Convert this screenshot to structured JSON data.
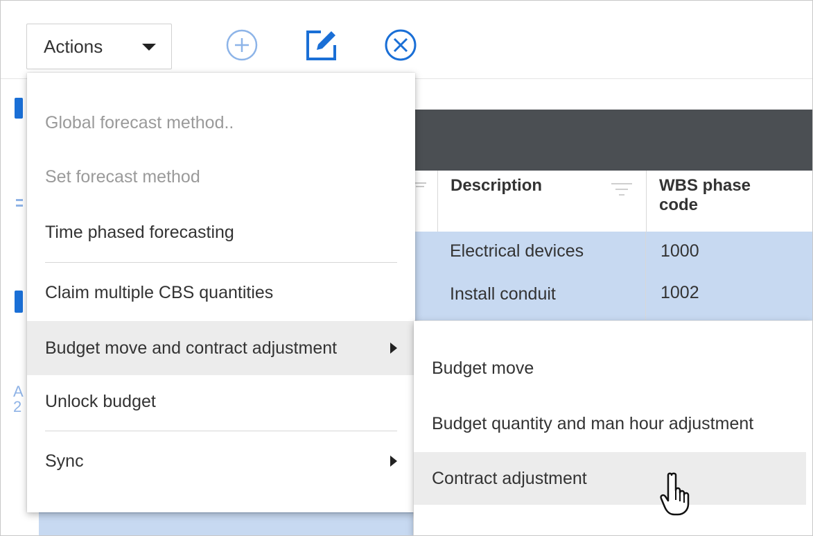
{
  "toolbar": {
    "actions_label": "Actions",
    "icons": [
      "add-icon",
      "edit-icon",
      "cancel-icon"
    ]
  },
  "grid": {
    "columns": [
      {
        "label": "Description"
      },
      {
        "label": "WBS phase code"
      }
    ],
    "rows": [
      {
        "description": "Electrical devices",
        "wbs": "1000"
      },
      {
        "description": "Install conduit",
        "wbs": "1002"
      }
    ],
    "left_partial_text": "A\n2"
  },
  "actions_menu": {
    "items": [
      {
        "label": "Global forecast method..",
        "disabled": true
      },
      {
        "label": "Set forecast method",
        "disabled": true
      },
      {
        "label": "Time phased forecasting",
        "disabled": false
      },
      {
        "label": "Claim multiple CBS quantities",
        "disabled": false
      },
      {
        "label": "Budget move and contract adjustment",
        "disabled": false,
        "has_submenu": true,
        "highlighted": true
      },
      {
        "label": "Unlock budget",
        "disabled": false
      },
      {
        "label": "Sync",
        "disabled": false,
        "has_submenu": true
      }
    ]
  },
  "submenu": {
    "items": [
      {
        "label": "Budget move"
      },
      {
        "label": "Budget quantity and man hour adjustment"
      },
      {
        "label": "Contract adjustment",
        "hovered": true
      }
    ]
  },
  "colors": {
    "accent_blue": "#1a6fd6",
    "header_dark": "#4b4f53",
    "selected_row": "#c7d9f1"
  }
}
